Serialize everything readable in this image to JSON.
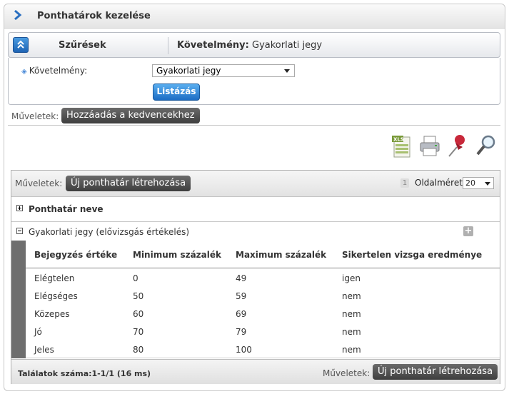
{
  "header": {
    "title": "Ponthatárok kezelése"
  },
  "filter": {
    "label": "Szűrések",
    "summary_key": "Követelmény:",
    "summary_value": "Gyakorlati jegy",
    "field_label": "Követelmény:",
    "field_value": "Gyakorlati jegy",
    "list_button": "Listázás"
  },
  "actions": {
    "label": "Műveletek:",
    "favorite_button": "Hozzáadás a kedvencekhez"
  },
  "toolbar": {
    "icons": [
      "excel-export-icon",
      "print-icon",
      "pin-icon",
      "search-icon"
    ]
  },
  "grid": {
    "ops_label": "Műveletek:",
    "create_button": "Új ponthatár létrehozása",
    "page_number": "1",
    "page_size_label": "Oldalméret",
    "page_size_value": "20",
    "column_header": "Ponthatár neve",
    "group_label": "Gyakorlati jegy (elővizsgás értékelés)",
    "add_symbol": "+",
    "sub_headers": [
      "Bejegyzés értéke",
      "Minimum százalék",
      "Maximum százalék",
      "Sikertelen vizsga eredménye"
    ],
    "rows": [
      [
        "Elégtelen",
        "0",
        "49",
        "igen"
      ],
      [
        "Elégséges",
        "50",
        "59",
        "nem"
      ],
      [
        "Közepes",
        "60",
        "69",
        "nem"
      ],
      [
        "Jó",
        "70",
        "79",
        "nem"
      ],
      [
        "Jeles",
        "80",
        "100",
        "nem"
      ]
    ],
    "results": "Találatok száma:1-1/1 (16 ms)",
    "footer_ops_label": "Műveletek:",
    "footer_create_button": "Új ponthatár létrehozása"
  },
  "colors": {
    "accent_blue": "#1c6cc4",
    "dark_button": "#3e3e3e",
    "side_bar": "#6e6e6e"
  }
}
